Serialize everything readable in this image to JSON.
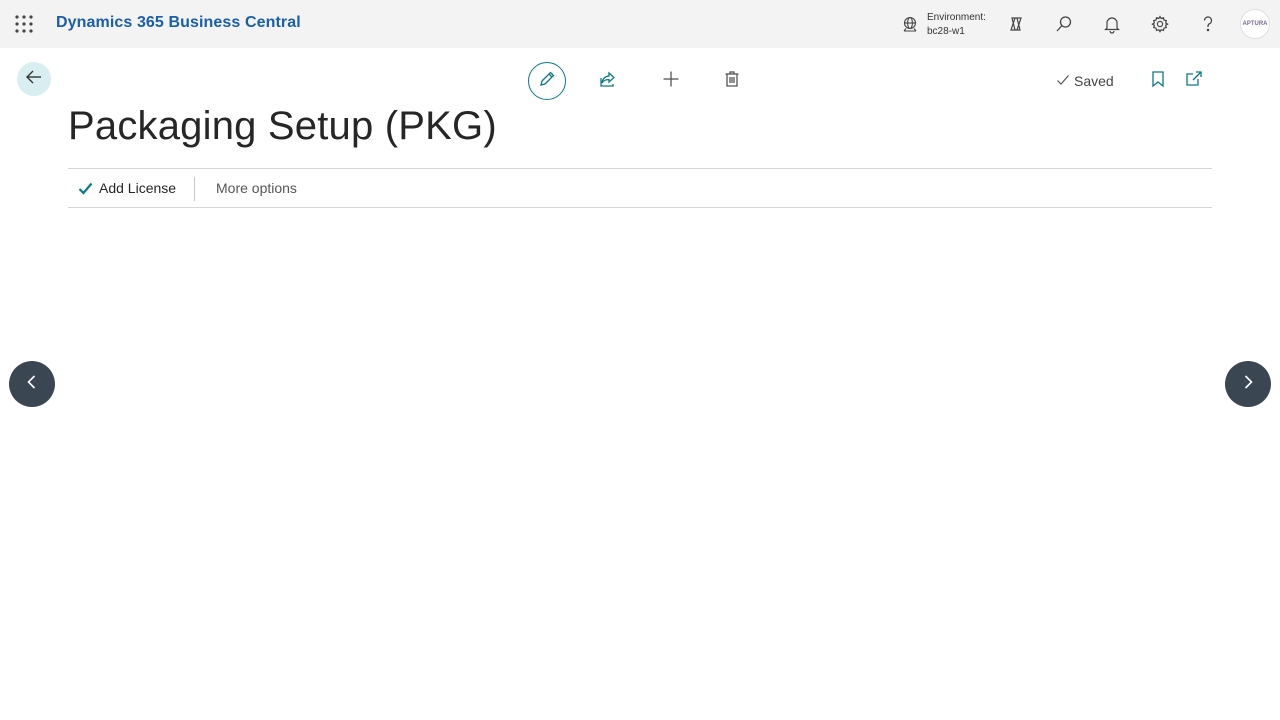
{
  "appbar": {
    "app_title": "Dynamics 365 Business Central",
    "environment_label": "Environment:",
    "environment_value": "bc28-w1",
    "avatar_text": "APTURA"
  },
  "header": {
    "saved_label": "Saved",
    "page_title": "Packaging Setup (PKG)"
  },
  "actions": {
    "add_license": "Add License",
    "more_options": "More options"
  },
  "colors": {
    "accent": "#0b7a85",
    "brand_title": "#1a5fa8",
    "nav_arrow_bg": "#3b4653",
    "appbar_bg": "#f3f3f3"
  },
  "icons": [
    "app-launcher-icon",
    "environment-icon",
    "copilot-icon",
    "search-icon",
    "bell-icon",
    "gear-icon",
    "help-icon",
    "back-arrow-icon",
    "pencil-icon",
    "share-icon",
    "plus-icon",
    "trash-icon",
    "checkmark-icon",
    "bookmark-icon",
    "open-new-window-icon",
    "chevron-left-icon",
    "chevron-right-icon"
  ]
}
